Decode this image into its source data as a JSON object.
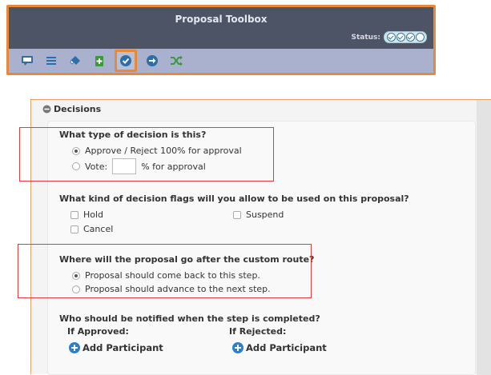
{
  "toolbox": {
    "title": "Proposal Toolbox",
    "status_label": "Status:",
    "status_pills": [
      "done",
      "done",
      "done",
      "pending"
    ],
    "tools": [
      {
        "name": "comment-icon"
      },
      {
        "name": "list-icon"
      },
      {
        "name": "eraser-icon"
      },
      {
        "name": "add-document-icon"
      },
      {
        "name": "check-circle-icon"
      },
      {
        "name": "forward-circle-icon"
      },
      {
        "name": "shuffle-icon"
      }
    ],
    "active_tool": "check-circle-icon"
  },
  "decisions": {
    "header": "Decisions",
    "decision_type": {
      "question": "What type of decision is this?",
      "option_approve": "Approve / Reject 100% for approval",
      "option_vote_prefix": "Vote:",
      "option_vote_suffix": "% for approval",
      "vote_value": "",
      "selected": "approve"
    },
    "flags": {
      "question": "What kind of decision flags will you allow to be used on this proposal?",
      "hold": "Hold",
      "suspend": "Suspend",
      "cancel": "Cancel"
    },
    "route": {
      "question": "Where will the proposal go after the custom route?",
      "option_back": "Proposal should come back to this step.",
      "option_next": "Proposal should advance to the next step.",
      "selected": "back"
    },
    "notify": {
      "question": "Who should be notified when the step is completed?",
      "if_approved": "If Approved:",
      "if_rejected": "If Rejected:",
      "add_participant": "Add Participant"
    }
  }
}
